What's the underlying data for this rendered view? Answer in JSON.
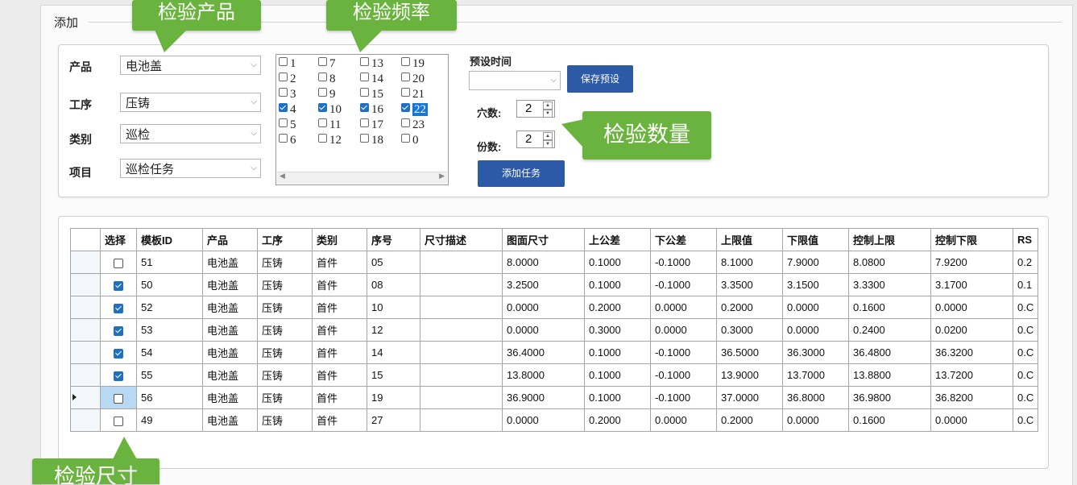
{
  "group_title": "添加",
  "form": {
    "product_label": "产品",
    "product_value": "电池盖",
    "process_label": "工序",
    "process_value": "压铸",
    "category_label": "类别",
    "category_value": "巡检",
    "item_label": "项目",
    "item_value": "巡检任务"
  },
  "frequency": {
    "items": [
      {
        "value": "1",
        "checked": false,
        "selected": false
      },
      {
        "value": "2",
        "checked": false,
        "selected": false
      },
      {
        "value": "3",
        "checked": false,
        "selected": false
      },
      {
        "value": "4",
        "checked": true,
        "selected": false
      },
      {
        "value": "5",
        "checked": false,
        "selected": false
      },
      {
        "value": "6",
        "checked": false,
        "selected": false
      },
      {
        "value": "7",
        "checked": false,
        "selected": false
      },
      {
        "value": "8",
        "checked": false,
        "selected": false
      },
      {
        "value": "9",
        "checked": false,
        "selected": false
      },
      {
        "value": "10",
        "checked": true,
        "selected": false
      },
      {
        "value": "11",
        "checked": false,
        "selected": false
      },
      {
        "value": "12",
        "checked": false,
        "selected": false
      },
      {
        "value": "13",
        "checked": false,
        "selected": false
      },
      {
        "value": "14",
        "checked": false,
        "selected": false
      },
      {
        "value": "15",
        "checked": false,
        "selected": false
      },
      {
        "value": "16",
        "checked": true,
        "selected": false
      },
      {
        "value": "17",
        "checked": false,
        "selected": false
      },
      {
        "value": "18",
        "checked": false,
        "selected": false
      },
      {
        "value": "19",
        "checked": false,
        "selected": false
      },
      {
        "value": "20",
        "checked": false,
        "selected": false
      },
      {
        "value": "21",
        "checked": false,
        "selected": false
      },
      {
        "value": "22",
        "checked": true,
        "selected": true
      },
      {
        "value": "23",
        "checked": false,
        "selected": false
      },
      {
        "value": "0",
        "checked": false,
        "selected": false
      }
    ]
  },
  "preset": {
    "label": "预设时间",
    "value": "",
    "save_button": "保存预设",
    "holes_label": "穴数:",
    "holes_value": "2",
    "copies_label": "份数:",
    "copies_value": "2",
    "add_task_button": "添加任务"
  },
  "callouts": {
    "product": "检验产品",
    "frequency": "检验频率",
    "quantity": "检验数量",
    "size": "检验尺寸"
  },
  "table": {
    "columns": [
      "选择",
      "模板ID",
      "产品",
      "工序",
      "类别",
      "序号",
      "尺寸描述",
      "图面尺寸",
      "上公差",
      "下公差",
      "上限值",
      "下限值",
      "控制上限",
      "控制下限",
      "RS"
    ],
    "rows": [
      {
        "checked": false,
        "current": false,
        "cells": [
          "51",
          "电池盖",
          "压铸",
          "首件",
          "05",
          "",
          "8.0000",
          "0.1000",
          "-0.1000",
          "8.1000",
          "7.9000",
          "8.0800",
          "7.9200",
          "0.2"
        ]
      },
      {
        "checked": true,
        "current": false,
        "cells": [
          "50",
          "电池盖",
          "压铸",
          "首件",
          "08",
          "",
          "3.2500",
          "0.1000",
          "-0.1000",
          "3.3500",
          "3.1500",
          "3.3300",
          "3.1700",
          "0.1"
        ]
      },
      {
        "checked": true,
        "current": false,
        "cells": [
          "52",
          "电池盖",
          "压铸",
          "首件",
          "10",
          "",
          "0.0000",
          "0.2000",
          "0.0000",
          "0.2000",
          "0.0000",
          "0.1600",
          "0.0000",
          "0.C"
        ]
      },
      {
        "checked": true,
        "current": false,
        "cells": [
          "53",
          "电池盖",
          "压铸",
          "首件",
          "12",
          "",
          "0.0000",
          "0.3000",
          "0.0000",
          "0.3000",
          "0.0000",
          "0.2400",
          "0.0200",
          "0.C"
        ]
      },
      {
        "checked": true,
        "current": false,
        "cells": [
          "54",
          "电池盖",
          "压铸",
          "首件",
          "14",
          "",
          "36.4000",
          "0.1000",
          "-0.1000",
          "36.5000",
          "36.3000",
          "36.4800",
          "36.3200",
          "0.C"
        ]
      },
      {
        "checked": true,
        "current": false,
        "cells": [
          "55",
          "电池盖",
          "压铸",
          "首件",
          "15",
          "",
          "13.8000",
          "0.1000",
          "-0.1000",
          "13.9000",
          "13.7000",
          "13.8800",
          "13.7200",
          "0.C"
        ]
      },
      {
        "checked": false,
        "current": true,
        "cells": [
          "56",
          "电池盖",
          "压铸",
          "首件",
          "19",
          "",
          "36.9000",
          "0.1000",
          "-0.1000",
          "37.0000",
          "36.8000",
          "36.9800",
          "36.8200",
          "0.C"
        ]
      },
      {
        "checked": false,
        "current": false,
        "cells": [
          "49",
          "电池盖",
          "压铸",
          "首件",
          "27",
          "",
          "0.0000",
          "0.2000",
          "0.0000",
          "0.2000",
          "0.0000",
          "0.1600",
          "0.0000",
          "0.C"
        ]
      }
    ]
  }
}
